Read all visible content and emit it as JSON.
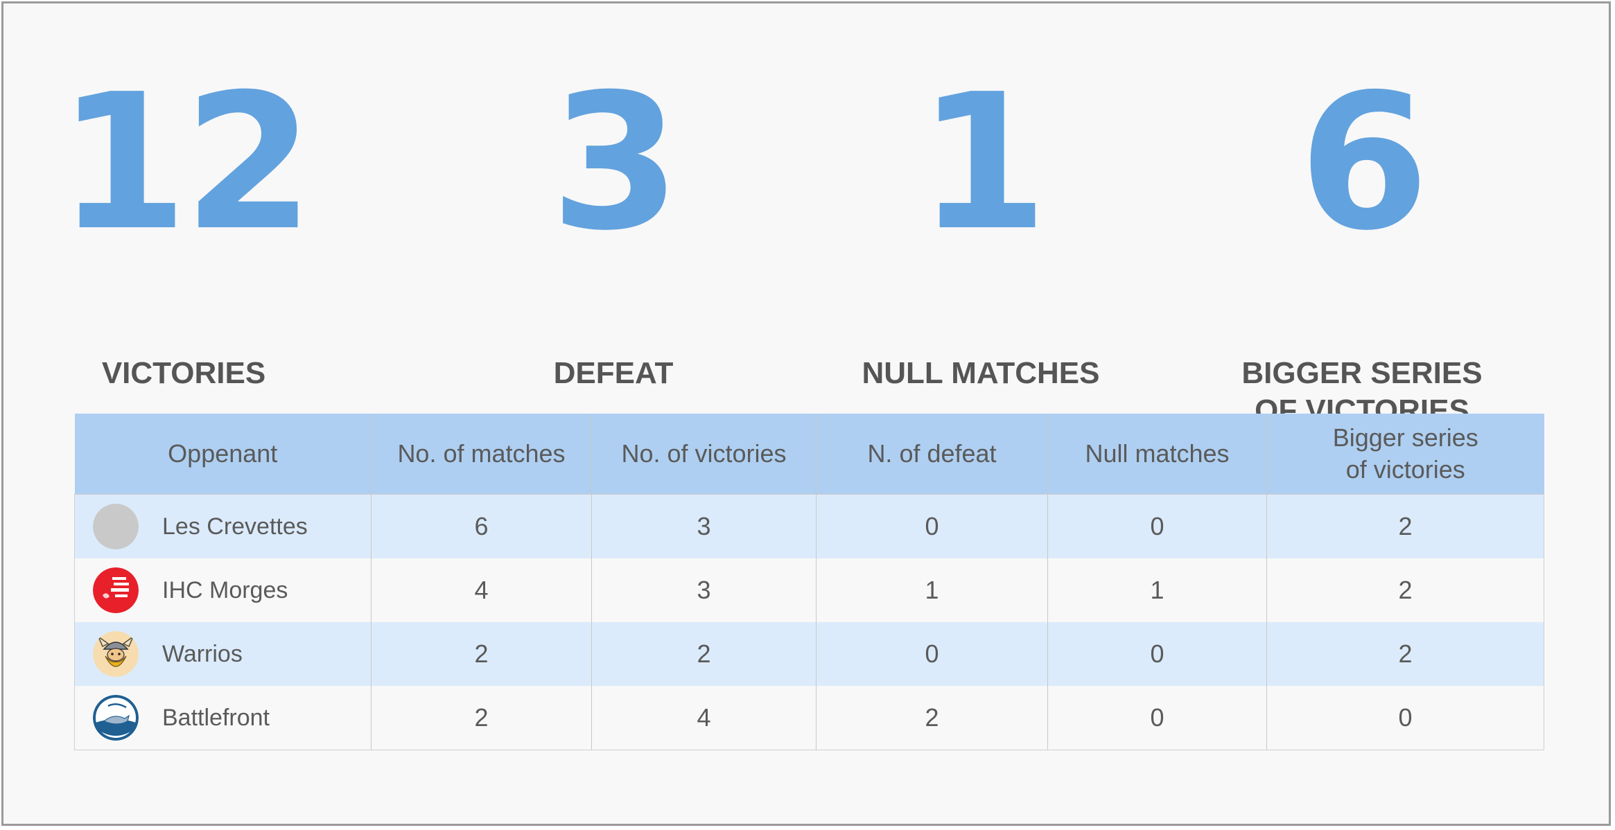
{
  "stats": [
    {
      "number": "12",
      "label": "VICTORIES"
    },
    {
      "number": "3",
      "label": "DEFEAT"
    },
    {
      "number": "1",
      "label": "NULL MATCHES"
    },
    {
      "number": "6",
      "label": "BIGGER SERIES\nOF VICTORIES"
    }
  ],
  "table": {
    "headers": [
      "Oppenant",
      "No. of matches",
      "No. of victories",
      "N. of defeat",
      "Null matches",
      "Bigger series\nof victories"
    ],
    "rows": [
      {
        "team": "Les Crevettes",
        "logo": "placeholder-logo-icon",
        "matches": "6",
        "victories": "3",
        "defeat": "0",
        "null": "0",
        "series": "2"
      },
      {
        "team": "IHC Morges",
        "logo": "ihc-morges-logo-icon",
        "matches": "4",
        "victories": "3",
        "defeat": "1",
        "null": "1",
        "series": "2"
      },
      {
        "team": "Warrios",
        "logo": "viking-warrior-logo-icon",
        "matches": "2",
        "victories": "2",
        "defeat": "0",
        "null": "0",
        "series": "2"
      },
      {
        "team": "Battlefront",
        "logo": "shark-logo-icon",
        "matches": "2",
        "victories": "4",
        "defeat": "2",
        "null": "0",
        "series": "0"
      }
    ]
  },
  "colors": {
    "accent": "#62a2de",
    "header_bg": "#aecff1",
    "row_highlight": "#dcebfb",
    "text": "#555555"
  }
}
